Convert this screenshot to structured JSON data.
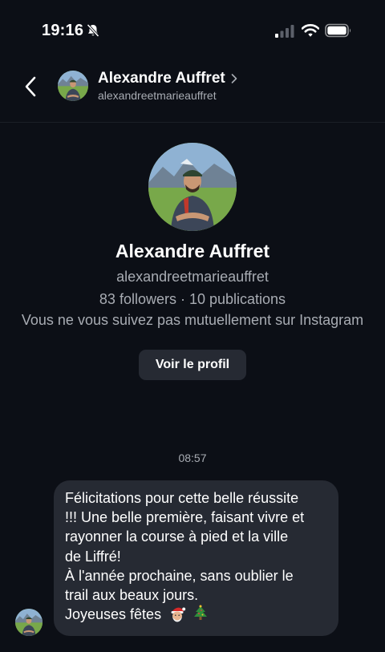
{
  "status_bar": {
    "time": "19:16",
    "icons": [
      "bell-slash-icon",
      "signal-icon",
      "wifi-icon",
      "battery-icon"
    ]
  },
  "header": {
    "name": "Alexandre Auffret",
    "username": "alexandreetmarieauffret",
    "icons": [
      "back-chevron-icon",
      "chevron-right-icon"
    ]
  },
  "profile": {
    "name": "Alexandre Auffret",
    "username": "alexandreetmarieauffret",
    "stats": "83 followers · 10 publications",
    "mutual_text": "Vous ne vous suivez pas mutuellement sur Instagram",
    "view_profile_label": "Voir le profil"
  },
  "conversation": {
    "timestamp": "08:57",
    "message": {
      "lines": [
        "Félicitations pour cette belle réussite",
        "!!! Une belle première, faisant vivre et",
        "rayonner la course à pied et la ville",
        "de Liffré!",
        "À l'année prochaine, sans oublier le",
        "trail aux beaux jours."
      ],
      "closing": "Joyeuses fêtes",
      "emojis": [
        "santa-emoji",
        "christmas-tree-emoji"
      ]
    }
  },
  "colors": {
    "background": "#0c0f16",
    "bubble": "#262a33",
    "secondary_text": "#a8acb3"
  }
}
